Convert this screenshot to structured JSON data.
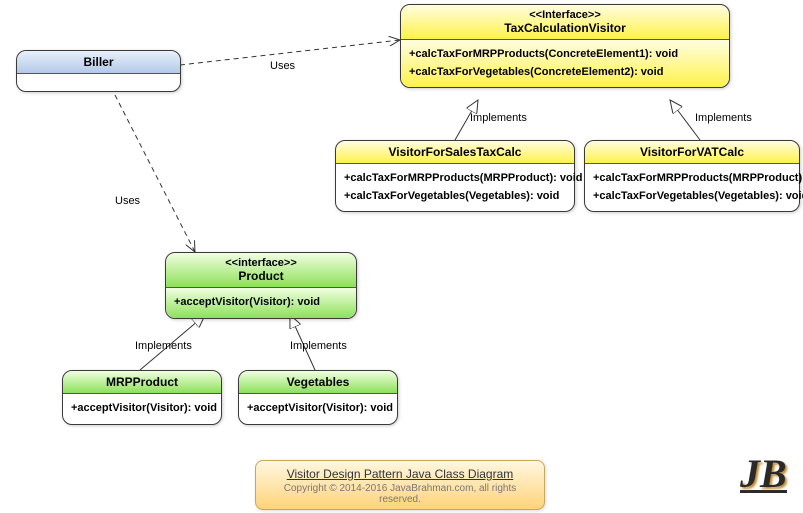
{
  "biller": {
    "name": "Biller"
  },
  "taxVisitor": {
    "stereotype": "<<Interface>>",
    "name": "TaxCalculationVisitor",
    "m1": "+calcTaxForMRPProducts(ConcreteElement1): void",
    "m2": "+calcTaxForVegetables(ConcreteElement2): void"
  },
  "salesTax": {
    "name": "VisitorForSalesTaxCalc",
    "m1": "+calcTaxForMRPProducts(MRPProduct): void",
    "m2": "+calcTaxForVegetables(Vegetables): void"
  },
  "vat": {
    "name": "VisitorForVATCalc",
    "m1": "+calcTaxForMRPProducts(MRPProduct): void",
    "m2": "+calcTaxForVegetables(Vegetables): void"
  },
  "product": {
    "stereotype": "<<interface>>",
    "name": "Product",
    "m1": "+acceptVisitor(Visitor): void"
  },
  "mrp": {
    "name": "MRPProduct",
    "m1": "+acceptVisitor(Visitor): void"
  },
  "veg": {
    "name": "Vegetables",
    "m1": "+acceptVisitor(Visitor): void"
  },
  "labels": {
    "uses": "Uses",
    "implements": "Implements"
  },
  "footer": {
    "title": "Visitor Design Pattern Java Class Diagram",
    "copy": "Copyright © 2014-2016 JavaBrahman.com, all rights reserved."
  },
  "logo": "JB",
  "chart_data": {
    "type": "uml-class-diagram",
    "title": "Visitor Design Pattern Java Class Diagram",
    "classes": [
      {
        "id": "Biller",
        "kind": "class",
        "methods": []
      },
      {
        "id": "TaxCalculationVisitor",
        "kind": "interface",
        "methods": [
          "+calcTaxForMRPProducts(ConcreteElement1): void",
          "+calcTaxForVegetables(ConcreteElement2): void"
        ]
      },
      {
        "id": "VisitorForSalesTaxCalc",
        "kind": "class",
        "methods": [
          "+calcTaxForMRPProducts(MRPProduct): void",
          "+calcTaxForVegetables(Vegetables): void"
        ]
      },
      {
        "id": "VisitorForVATCalc",
        "kind": "class",
        "methods": [
          "+calcTaxForMRPProducts(MRPProduct): void",
          "+calcTaxForVegetables(Vegetables): void"
        ]
      },
      {
        "id": "Product",
        "kind": "interface",
        "methods": [
          "+acceptVisitor(Visitor): void"
        ]
      },
      {
        "id": "MRPProduct",
        "kind": "class",
        "methods": [
          "+acceptVisitor(Visitor): void"
        ]
      },
      {
        "id": "Vegetables",
        "kind": "class",
        "methods": [
          "+acceptVisitor(Visitor): void"
        ]
      }
    ],
    "relationships": [
      {
        "from": "Biller",
        "to": "TaxCalculationVisitor",
        "type": "dependency",
        "label": "Uses"
      },
      {
        "from": "Biller",
        "to": "Product",
        "type": "dependency",
        "label": "Uses"
      },
      {
        "from": "VisitorForSalesTaxCalc",
        "to": "TaxCalculationVisitor",
        "type": "realization",
        "label": "Implements"
      },
      {
        "from": "VisitorForVATCalc",
        "to": "TaxCalculationVisitor",
        "type": "realization",
        "label": "Implements"
      },
      {
        "from": "MRPProduct",
        "to": "Product",
        "type": "realization",
        "label": "Implements"
      },
      {
        "from": "Vegetables",
        "to": "Product",
        "type": "realization",
        "label": "Implements"
      }
    ]
  }
}
